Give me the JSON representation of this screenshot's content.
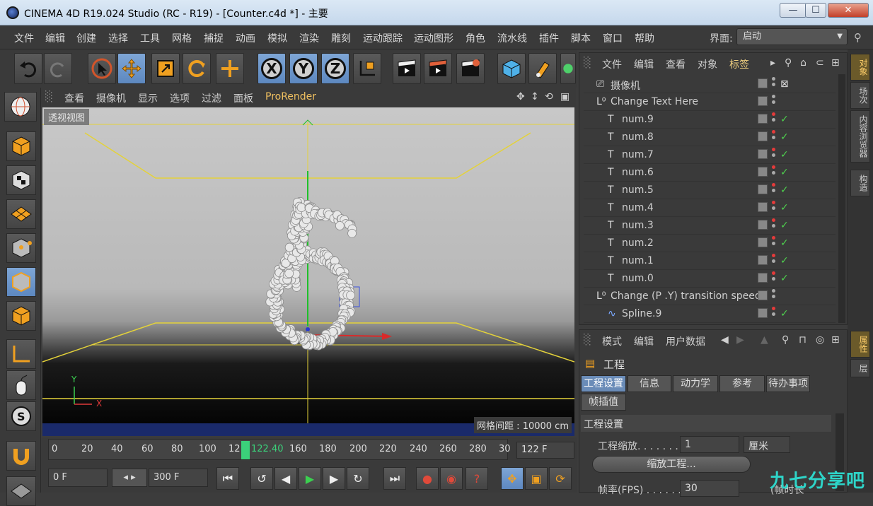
{
  "window": {
    "title": "CINEMA 4D R19.024 Studio (RC - R19) - [Counter.c4d *] - 主要",
    "minimize": "—",
    "maximize": "☐",
    "close": "✕"
  },
  "menubar": {
    "items": [
      "文件",
      "编辑",
      "创建",
      "选择",
      "工具",
      "网格",
      "捕捉",
      "动画",
      "模拟",
      "渲染",
      "雕刻",
      "运动跟踪",
      "运动图形",
      "角色",
      "流水线",
      "插件",
      "脚本",
      "窗口",
      "帮助"
    ],
    "interface_label": "界面:",
    "interface_value": "启动"
  },
  "toolbar": {
    "x": "X",
    "y": "Y",
    "z": "Z"
  },
  "viewport": {
    "menu": [
      "查看",
      "摄像机",
      "显示",
      "选项",
      "过滤",
      "面板",
      "ProRender"
    ],
    "label": "透视视图",
    "grid_spacing": "网格间距 : 10000 cm",
    "axis_y": "Y",
    "axis_x": "X"
  },
  "timeline": {
    "ticks": [
      "0",
      "20",
      "40",
      "60",
      "80",
      "100",
      "12",
      "160",
      "180",
      "200",
      "220",
      "240",
      "260",
      "280",
      "30"
    ],
    "playhead": "122.40",
    "end_frame": "122 F",
    "start_field": "0 F",
    "end_field": "300 F"
  },
  "side_tabs": [
    "对象",
    "场次",
    "内容浏览器",
    "构造",
    "属性",
    "层"
  ],
  "object_manager": {
    "menu": [
      "文件",
      "编辑",
      "查看",
      "对象",
      "标签"
    ],
    "rows": [
      {
        "name": "摄像机",
        "indent": 1,
        "type": "camera"
      },
      {
        "name": "Change Text Here",
        "indent": 0,
        "type": "null"
      },
      {
        "name": "num.9",
        "indent": 2,
        "type": "text"
      },
      {
        "name": "num.8",
        "indent": 2,
        "type": "text"
      },
      {
        "name": "num.7",
        "indent": 2,
        "type": "text"
      },
      {
        "name": "num.6",
        "indent": 2,
        "type": "text"
      },
      {
        "name": "num.5",
        "indent": 2,
        "type": "text"
      },
      {
        "name": "num.4",
        "indent": 2,
        "type": "text"
      },
      {
        "name": "num.3",
        "indent": 2,
        "type": "text"
      },
      {
        "name": "num.2",
        "indent": 2,
        "type": "text"
      },
      {
        "name": "num.1",
        "indent": 2,
        "type": "text"
      },
      {
        "name": "num.0",
        "indent": 2,
        "type": "text"
      },
      {
        "name": "Change (P .Y) transition speed",
        "indent": 0,
        "type": "null"
      },
      {
        "name": "Spline.9",
        "indent": 2,
        "type": "spline"
      }
    ]
  },
  "attributes": {
    "menu": [
      "模式",
      "编辑",
      "用户数据"
    ],
    "project_title": "工程",
    "tabs": [
      "工程设置",
      "信息",
      "动力学",
      "参考",
      "待办事项",
      "帧插值"
    ],
    "section": "工程设置",
    "scale_label": "工程缩放. . . . . . .",
    "scale_value": "1",
    "unit": "厘米",
    "scale_button": "缩放工程...",
    "fps_label": "帧率(FPS) . . . . . .",
    "fps_value": "30",
    "extra": "(帧时长"
  },
  "watermark": "九七分享吧"
}
